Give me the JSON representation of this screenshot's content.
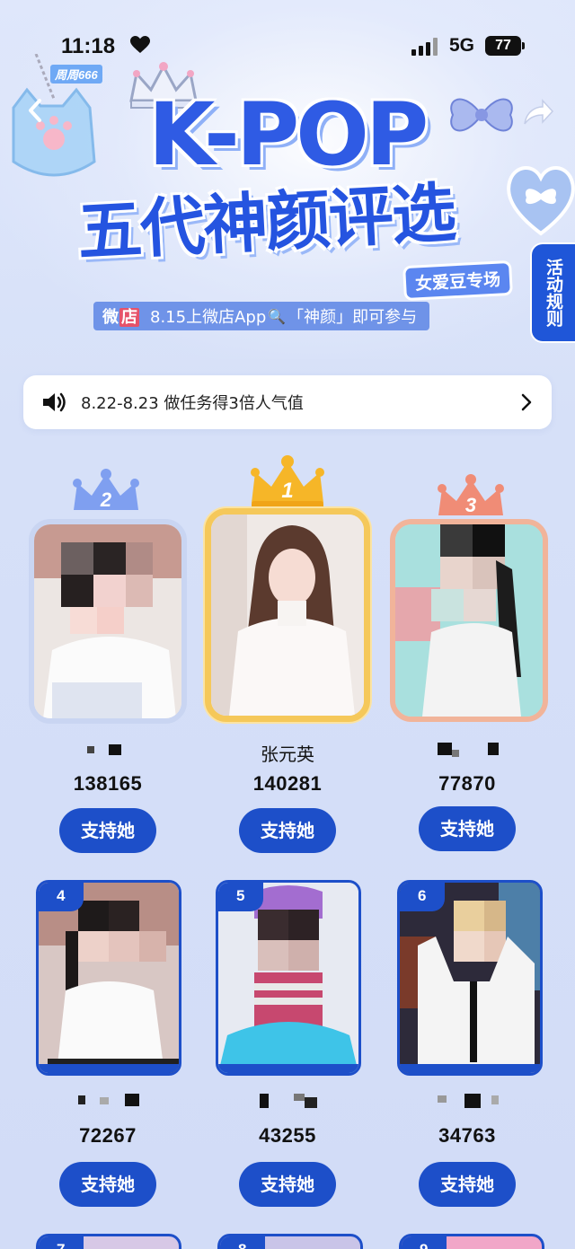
{
  "status_bar": {
    "time": "11:18",
    "network": "5G",
    "battery": "77",
    "sub_tag": "周周666"
  },
  "hero": {
    "kpop": "K-POP",
    "title": "五代神颜评选",
    "badge": "女爱豆专场",
    "promo": {
      "weidian_a": "微",
      "weidian_b": "店",
      "text_a": "8.15上微店App",
      "text_b": "「神颜」即可参与"
    },
    "rules_tab": "活动规则"
  },
  "notice": {
    "text": "8.22-8.23 做任务得3倍人气值"
  },
  "podium": [
    {
      "rank": "2",
      "name": "",
      "votes": "138165",
      "button": "支持她",
      "crown_color": "#7f9ff0",
      "frame_color": "#c9d5f2"
    },
    {
      "rank": "1",
      "name": "张元英",
      "votes": "140281",
      "button": "支持她",
      "crown_color": "#f6b628",
      "frame_color": "#f5c85a"
    },
    {
      "rank": "3",
      "name": "",
      "votes": "77870",
      "button": "支持她",
      "crown_color": "#f08c76",
      "frame_color": "#f1b49a"
    }
  ],
  "grid": [
    {
      "rank": "4",
      "name": "",
      "votes": "72267",
      "button": "支持她"
    },
    {
      "rank": "5",
      "name": "",
      "votes": "43255",
      "button": "支持她"
    },
    {
      "rank": "6",
      "name": "",
      "votes": "34763",
      "button": "支持她"
    }
  ],
  "peek_row": [
    {
      "rank": "7"
    },
    {
      "rank": "8"
    },
    {
      "rank": "9"
    }
  ],
  "colors": {
    "accent": "#1d4fc9",
    "title_blue": "#2f5be4",
    "gold": "#f6b628",
    "silver": "#7f9ff0",
    "bronze": "#f08c76"
  }
}
